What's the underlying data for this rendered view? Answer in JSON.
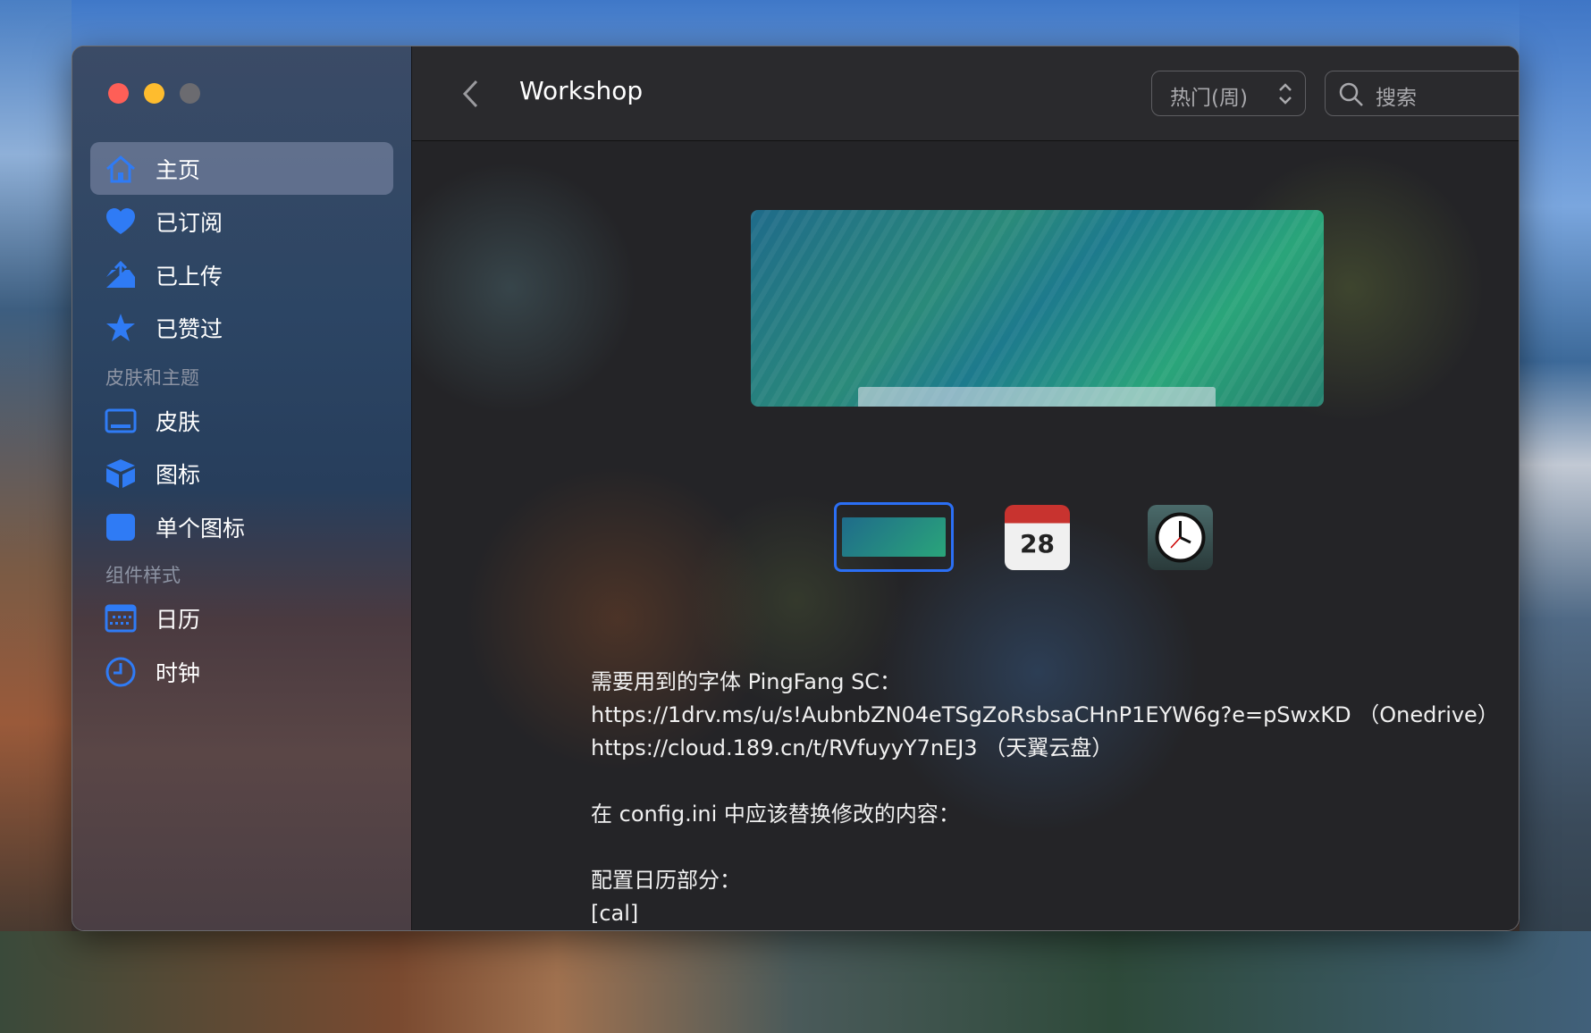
{
  "window": {
    "title": "Workshop"
  },
  "sidebar": {
    "items": [
      {
        "label": "主页",
        "icon": "house-icon"
      },
      {
        "label": "已订阅",
        "icon": "heart-icon"
      },
      {
        "label": "已上传",
        "icon": "upload-tray-icon"
      },
      {
        "label": "已赞过",
        "icon": "star-icon"
      }
    ],
    "section1": "皮肤和主题",
    "items2": [
      {
        "label": "皮肤",
        "icon": "skin-icon"
      },
      {
        "label": "图标",
        "icon": "cube-icon"
      },
      {
        "label": "单个图标",
        "icon": "square-icon"
      }
    ],
    "section2": "组件样式",
    "items3": [
      {
        "label": "日历",
        "icon": "calendar-icon"
      },
      {
        "label": "时钟",
        "icon": "clock-icon"
      }
    ]
  },
  "header": {
    "sort": "热门(周)",
    "search_placeholder": "搜索"
  },
  "thumbs": {
    "calendar_day": "28"
  },
  "description": [
    "需要用到的字体 PingFang SC：",
    "https://1drv.ms/u/s!AubnbZN04eTSgZoRsbsaCHnP1EYW6g?e=pSwxKD （Onedrive）",
    "https://cloud.189.cn/t/RVfuyyY7nEJ3 （天翼云盘）",
    "",
    "在 config.ini 中应该替换修改的内容：",
    "",
    "配置日历部分：",
    "[cal]"
  ],
  "colors": {
    "accent": "#2f7bf5",
    "close": "#fe5f57",
    "minimize": "#febc2e",
    "zoom": "#6b6b70"
  }
}
